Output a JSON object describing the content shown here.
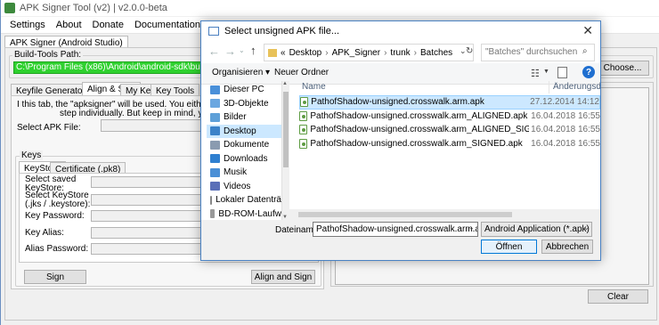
{
  "app": {
    "title": "APK Signer Tool (v2) | v2.0.0-beta",
    "menu": [
      "Settings",
      "About",
      "Donate",
      "Documentation"
    ],
    "main_tab": "APK Signer (Android Studio)",
    "build_tools_label": "Build-Tools Path:",
    "build_tools_value": "C:\\Program Files (x86)\\Android\\android-sdk\\build-tools",
    "choose_button": "Choose...",
    "inner_tabs": [
      "Keyfile Generator (JDK)",
      "Align & Sign",
      "My Keys",
      "Key Tools"
    ],
    "info_line1": "I this tab, the \"apksigner\" will be used. You either can Align and Sig",
    "info_line2": "step individually. But keep in mind, you must Align yo",
    "select_apk_label": "Select APK File:",
    "keys_group": "Keys",
    "key_tabs": [
      "KeyStore",
      "Certificate (.pk8)"
    ],
    "saved_keystore_label": "Select saved KeyStore:",
    "select_keystore_label": "Select KeyStore (.jks / .keystore):",
    "key_password_label": "Key Password:",
    "key_alias_label": "Key Alias:",
    "alias_password_label": "Alias Password:",
    "sign_button": "Sign",
    "align_sign_button": "Align and Sign",
    "clear_button": "Clear"
  },
  "dialog": {
    "title": "Select unsigned APK file...",
    "breadcrumb": [
      "«",
      "Desktop",
      "APK_Signer",
      "trunk",
      "Batches"
    ],
    "search_placeholder": "\"Batches\" durchsuchen",
    "organize": "Organisieren ▾",
    "new_folder": "Neuer Ordner",
    "nav_items": [
      {
        "label": "Dieser PC",
        "icon": "computer-icon",
        "color": "#4a90d9"
      },
      {
        "label": "3D-Objekte",
        "icon": "cube-icon",
        "color": "#6aa7e0"
      },
      {
        "label": "Bilder",
        "icon": "pictures-icon",
        "color": "#5ea0d8"
      },
      {
        "label": "Desktop",
        "icon": "desktop-icon",
        "color": "#3b82c8"
      },
      {
        "label": "Dokumente",
        "icon": "documents-icon",
        "color": "#8a9bb0"
      },
      {
        "label": "Downloads",
        "icon": "downloads-icon",
        "color": "#2f7fd0"
      },
      {
        "label": "Musik",
        "icon": "music-icon",
        "color": "#4a8fd6"
      },
      {
        "label": "Videos",
        "icon": "videos-icon",
        "color": "#5a6fb8"
      },
      {
        "label": "Lokaler Datenträ",
        "icon": "drive-icon",
        "color": "#888"
      },
      {
        "label": "BD-ROM-Laufw",
        "icon": "disc-drive-icon",
        "color": "#999"
      }
    ],
    "col_name": "Name",
    "col_date": "Änderungsdatum",
    "files": [
      {
        "name": "PathofShadow-unsigned.crosswalk.arm.apk",
        "date": "27.12.2014 14:12",
        "selected": true
      },
      {
        "name": "PathofShadow-unsigned.crosswalk.arm_ALIGNED.apk",
        "date": "16.04.2018 16:55",
        "selected": false
      },
      {
        "name": "PathofShadow-unsigned.crosswalk.arm_ALIGNED_SIGNED.apk",
        "date": "16.04.2018 16:55",
        "selected": false
      },
      {
        "name": "PathofShadow-unsigned.crosswalk.arm_SIGNED.apk",
        "date": "16.04.2018 16:55",
        "selected": false
      }
    ],
    "filename_label": "Dateiname:",
    "filename_value": "PathofShadow-unsigned.crosswalk.arm.apk",
    "filetype_value": "Android Application (*.apk)",
    "open_button": "Öffnen",
    "cancel_button": "Abbrechen",
    "selection_color": "#cce8ff"
  }
}
